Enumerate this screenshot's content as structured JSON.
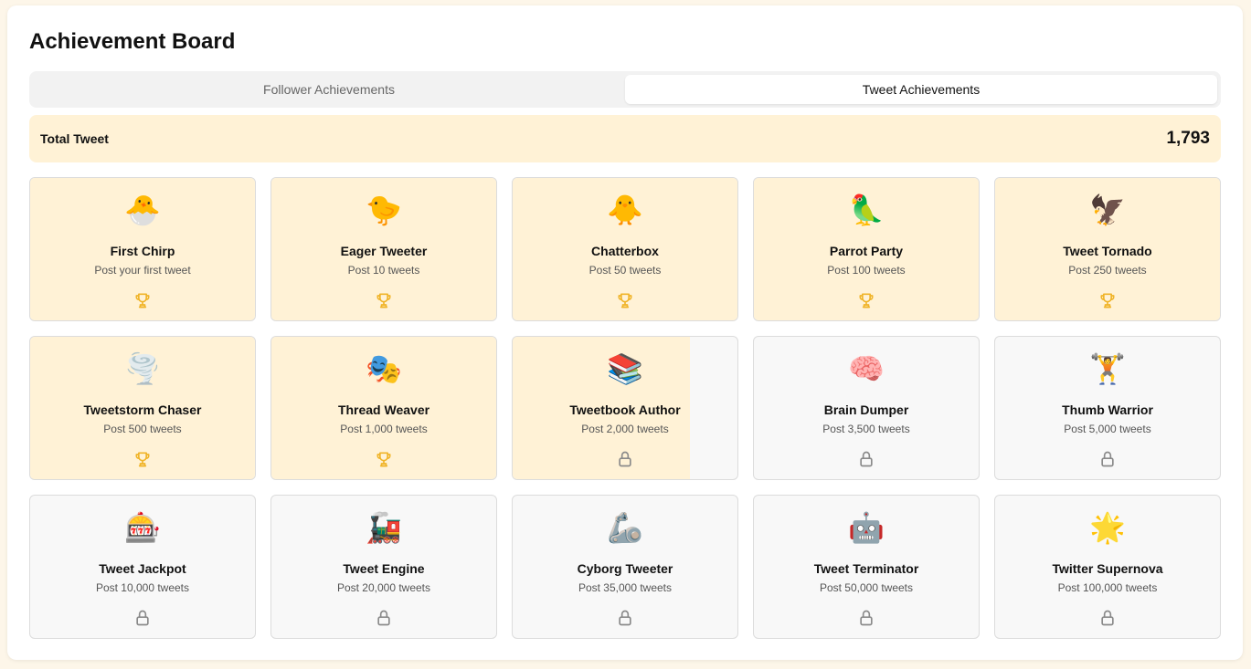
{
  "title": "Achievement Board",
  "tabs": [
    {
      "label": "Follower Achievements",
      "active": false
    },
    {
      "label": "Tweet Achievements",
      "active": true
    }
  ],
  "total": {
    "label": "Total Tweet",
    "value": "1,793"
  },
  "colors": {
    "unlocked": "#fff2d6",
    "locked": "#f8f8f8",
    "trophy": "#f0b429",
    "lock": "#8a8a8a"
  },
  "achievements": [
    {
      "emoji": "🐣",
      "icon": "hatching-chick-icon",
      "title": "First Chirp",
      "desc": "Post your first tweet",
      "progress": 1.0,
      "status": "unlocked"
    },
    {
      "emoji": "🐤",
      "icon": "baby-chick-icon",
      "title": "Eager Tweeter",
      "desc": "Post 10 tweets",
      "progress": 1.0,
      "status": "unlocked"
    },
    {
      "emoji": "🐥",
      "icon": "front-facing-chick-icon",
      "title": "Chatterbox",
      "desc": "Post 50 tweets",
      "progress": 1.0,
      "status": "unlocked"
    },
    {
      "emoji": "🦜",
      "icon": "parrot-icon",
      "title": "Parrot Party",
      "desc": "Post 100 tweets",
      "progress": 1.0,
      "status": "unlocked"
    },
    {
      "emoji": "🦅",
      "icon": "eagle-icon",
      "title": "Tweet Tornado",
      "desc": "Post 250 tweets",
      "progress": 1.0,
      "status": "unlocked"
    },
    {
      "emoji": "🌪️",
      "icon": "tornado-icon",
      "title": "Tweetstorm Chaser",
      "desc": "Post 500 tweets",
      "progress": 1.0,
      "status": "unlocked"
    },
    {
      "emoji": "🎭",
      "icon": "theater-masks-icon",
      "title": "Thread Weaver",
      "desc": "Post 1,000 tweets",
      "progress": 1.0,
      "status": "unlocked"
    },
    {
      "emoji": "📚",
      "icon": "books-icon",
      "title": "Tweetbook Author",
      "desc": "Post 2,000 tweets",
      "progress": 0.79,
      "status": "locked"
    },
    {
      "emoji": "🧠",
      "icon": "brain-icon",
      "title": "Brain Dumper",
      "desc": "Post 3,500 tweets",
      "progress": 0,
      "status": "locked"
    },
    {
      "emoji": "🏋️",
      "icon": "weightlifter-icon",
      "title": "Thumb Warrior",
      "desc": "Post 5,000 tweets",
      "progress": 0,
      "status": "locked"
    },
    {
      "emoji": "🎰",
      "icon": "slot-machine-icon",
      "title": "Tweet Jackpot",
      "desc": "Post 10,000 tweets",
      "progress": 0,
      "status": "locked"
    },
    {
      "emoji": "🚂",
      "icon": "locomotive-icon",
      "title": "Tweet Engine",
      "desc": "Post 20,000 tweets",
      "progress": 0,
      "status": "locked"
    },
    {
      "emoji": "🦾",
      "icon": "mechanical-arm-icon",
      "title": "Cyborg Tweeter",
      "desc": "Post 35,000 tweets",
      "progress": 0,
      "status": "locked"
    },
    {
      "emoji": "🤖",
      "icon": "robot-icon",
      "title": "Tweet Terminator",
      "desc": "Post 50,000 tweets",
      "progress": 0,
      "status": "locked"
    },
    {
      "emoji": "🌟",
      "icon": "glowing-star-icon",
      "title": "Twitter Supernova",
      "desc": "Post 100,000 tweets",
      "progress": 0,
      "status": "locked"
    }
  ]
}
